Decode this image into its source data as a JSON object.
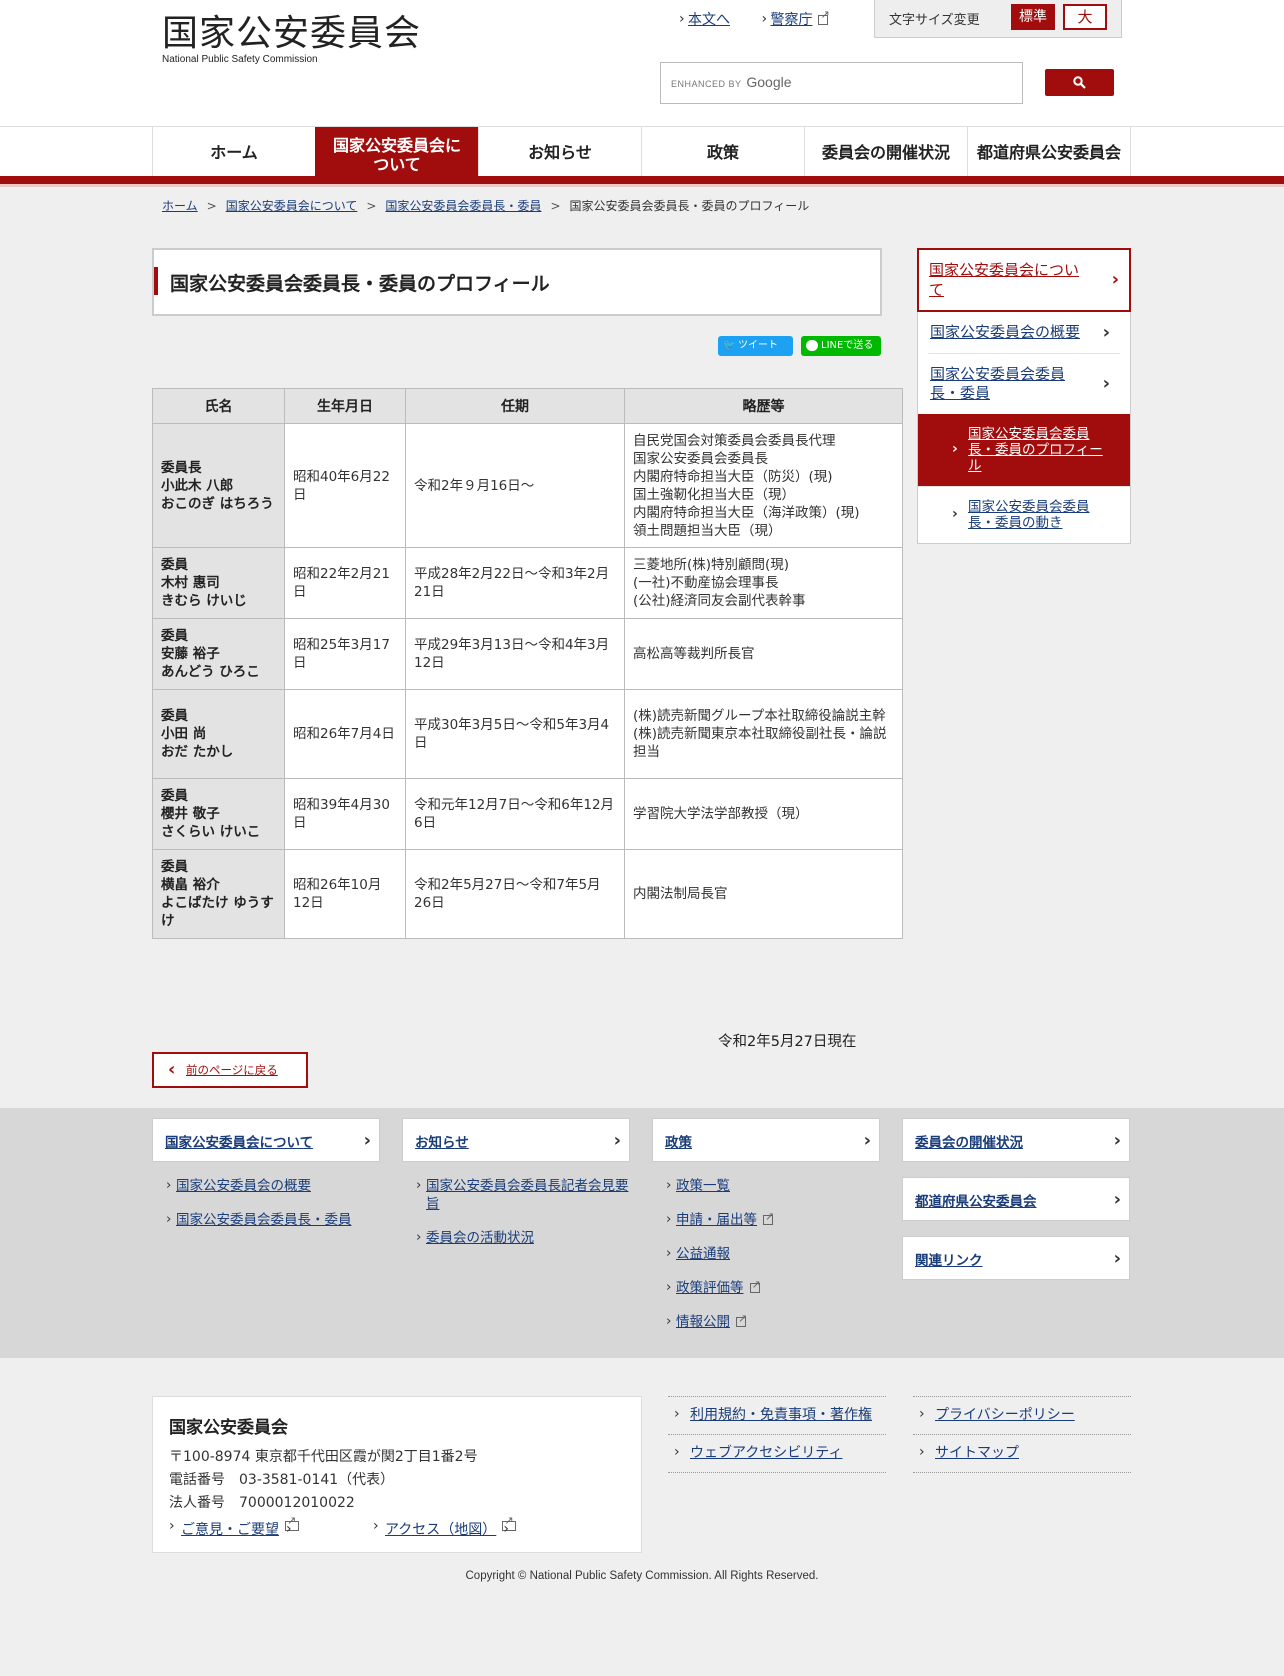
{
  "header": {
    "logo_jp": "国家公安委員会",
    "logo_en": "National Public Safety Commission",
    "link_main": "本文へ",
    "link_police": "警察庁",
    "fontsize_label": "文字サイズ変更",
    "fontsize_std": "標準",
    "fontsize_large": "大",
    "search_enhanced": "ENHANCED BY",
    "search_google": "Google"
  },
  "nav": {
    "home": "ホーム",
    "about": "国家公安委員会について",
    "news": "お知らせ",
    "policy": "政策",
    "meetings": "委員会の開催状況",
    "prefectural": "都道府県公安委員会"
  },
  "breadcrumb": {
    "home": "ホーム",
    "about": "国家公安委員会について",
    "members": "国家公安委員会委員長・委員",
    "current": "国家公安委員会委員長・委員のプロフィール",
    "sep": ">"
  },
  "page": {
    "title": "国家公安委員会委員長・委員のプロフィール",
    "tweet": "ツイート",
    "line": "LINEで送る",
    "as_of": "令和2年5月27日現在",
    "back": "前のページに戻る"
  },
  "table": {
    "headers": [
      "氏名",
      "生年月日",
      "任期",
      "略歴等"
    ],
    "rows": [
      {
        "role": "委員長",
        "name": "小此木 八郎",
        "kana": "おこのぎ はちろう",
        "birth": "昭和40年6月22日",
        "term": "令和2年９月16日～",
        "career": [
          "自民党国会対策委員会委員長代理",
          "国家公安委員会委員長",
          "内閣府特命担当大臣（防災）(現)",
          "国土強靭化担当大臣（現）",
          "内閣府特命担当大臣（海洋政策）(現)",
          "領土問題担当大臣（現）"
        ]
      },
      {
        "role": "委員",
        "name": "木村 惠司",
        "kana": "きむら けいじ",
        "birth": "昭和22年2月21日",
        "term": "平成28年2月22日～令和3年2月21日",
        "career": [
          "三菱地所(株)特別顧問(現)",
          "(一社)不動産協会理事長",
          "(公社)経済同友会副代表幹事"
        ]
      },
      {
        "role": "委員",
        "name": "安藤 裕子",
        "kana": "あんどう ひろこ",
        "birth": "昭和25年3月17日",
        "term": "平成29年3月13日～令和4年3月12日",
        "career": [
          "高松高等裁判所長官"
        ]
      },
      {
        "role": "委員",
        "name": "小田 尚",
        "kana": "おだ たかし",
        "birth": "昭和26年7月4日",
        "term": "平成30年3月5日～令和5年3月4日",
        "career": [
          "(株)読売新聞グループ本社取締役論説主幹",
          "(株)読売新聞東京本社取締役副社長・論説担当"
        ]
      },
      {
        "role": "委員",
        "name": "櫻井 敬子",
        "kana": "さくらい けいこ",
        "birth": "昭和39年4月30日",
        "term": "令和元年12月7日～令和6年12月6日",
        "career": [
          "学習院大学法学部教授（現）"
        ]
      },
      {
        "role": "委員",
        "name": "横畠 裕介",
        "kana": "よこばたけ ゆうすけ",
        "birth": "昭和26年10月12日",
        "term": "令和2年5月27日～令和7年5月26日",
        "career": [
          "内閣法制局長官"
        ]
      }
    ]
  },
  "sidebar": {
    "head": "国家公安委員会について",
    "items": [
      "国家公安委員会の概要",
      "国家公安委員会委員長・委員"
    ],
    "sub_current": "国家公安委員会委員長・委員のプロフィール",
    "sub_other": "国家公安委員会委員長・委員の動き"
  },
  "footer_nav": {
    "about": {
      "title": "国家公安委員会について",
      "links": [
        "国家公安委員会の概要",
        "国家公安委員会委員長・委員"
      ]
    },
    "news": {
      "title": "お知らせ",
      "links": [
        "国家公安委員会委員長記者会見要旨",
        "委員会の活動状況"
      ]
    },
    "policy": {
      "title": "政策",
      "links": [
        "政策一覧",
        "申請・届出等",
        "公益通報",
        "政策評価等",
        "情報公開"
      ]
    },
    "meetings": "委員会の開催状況",
    "prefectural": "都道府県公安委員会",
    "related": "関連リンク"
  },
  "footer": {
    "org_name": "国家公安委員会",
    "address": "〒100-8974 東京都千代田区霞が関2丁目1番2号",
    "phone": "電話番号　03-3581-0141（代表）",
    "corp": "法人番号　7000012010022",
    "opinion": "ご意見・ご要望",
    "access": "アクセス（地図）",
    "terms": "利用規約・免責事項・著作権",
    "accessibility": "ウェブアクセシビリティ",
    "privacy": "プライバシーポリシー",
    "sitemap": "サイトマップ",
    "copyright": "Copyright © National Public Safety Commission. All Rights Reserved."
  }
}
